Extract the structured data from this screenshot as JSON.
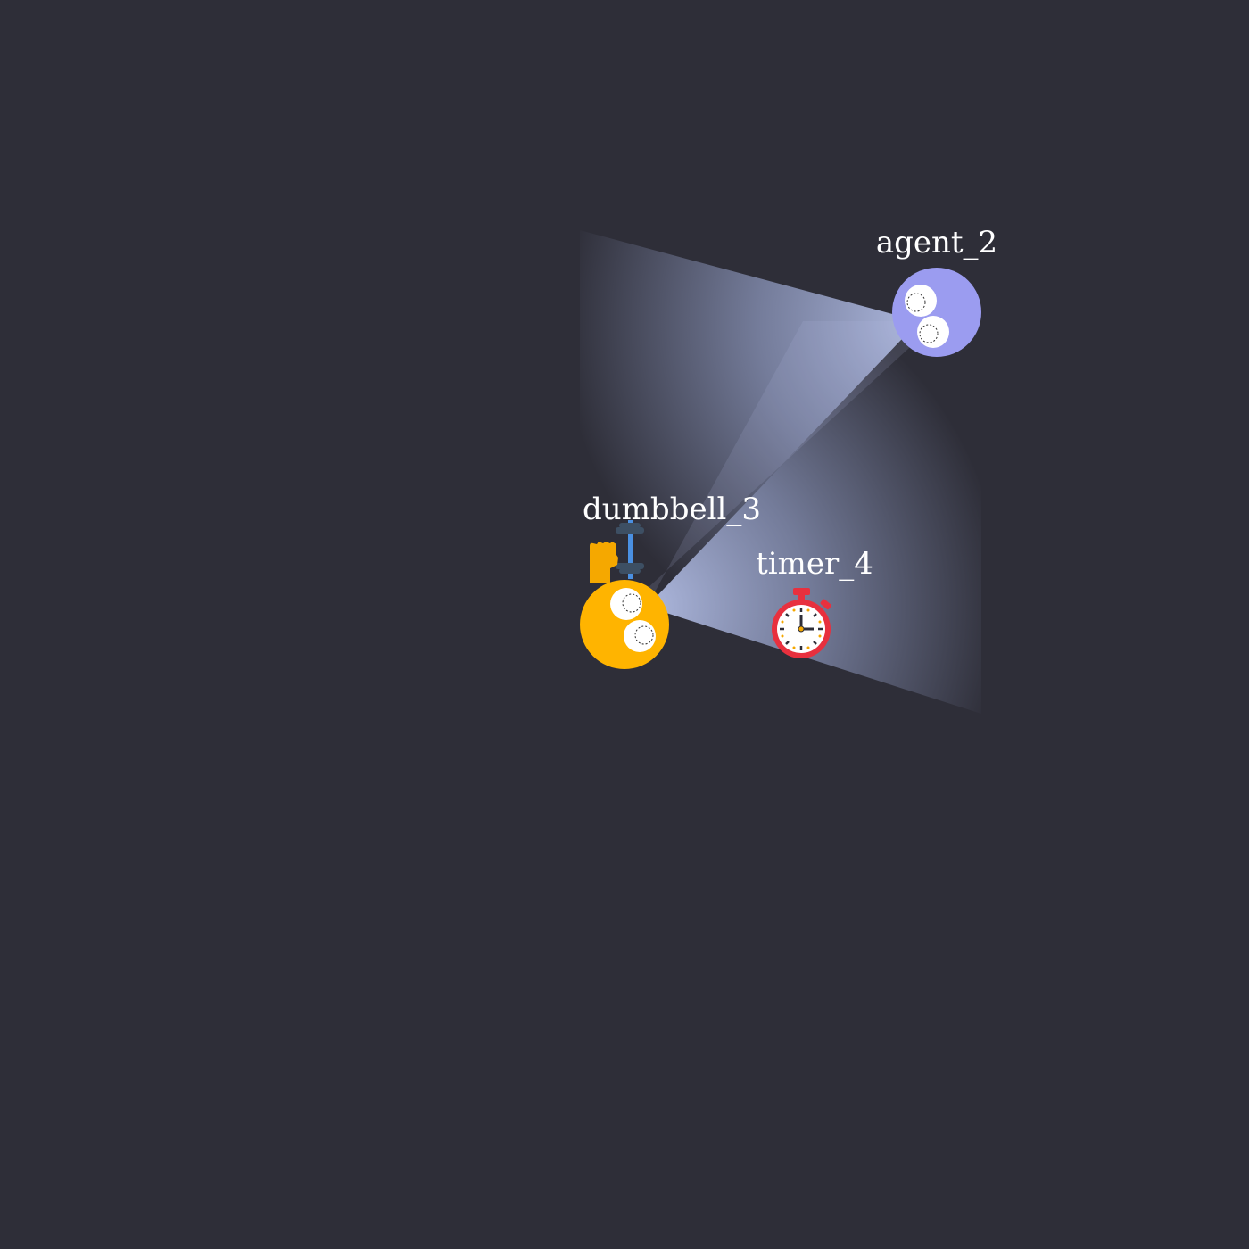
{
  "entities": {
    "agent_2": {
      "label": "agent_2",
      "body_color": "#9b9cf0",
      "icon": "agent-face"
    },
    "dumbbell_3": {
      "label": "dumbbell_3",
      "body_color": "#ffb400",
      "icon": "dumbbell-icon",
      "held_icon": "fist-icon",
      "held_icon_color": "#f5a800",
      "dumbbell_bar_color": "#4a90e2",
      "dumbbell_plate_color": "#3d4f63"
    },
    "timer_4": {
      "label": "timer_4",
      "icon": "stopwatch-icon",
      "icon_color": "#e8303e"
    }
  },
  "colors": {
    "background": "#2e2e38",
    "vision_cone": "#b4bfe6",
    "eye_white": "#ffffff"
  }
}
